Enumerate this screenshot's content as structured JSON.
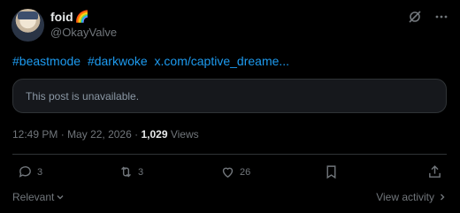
{
  "author": {
    "display_name": "foid",
    "emoji": "🌈",
    "handle": "@OkayValve"
  },
  "post": {
    "hashtag1": "#beastmode",
    "hashtag2": "#darkwoke",
    "link": "x.com/captive_dreame..."
  },
  "quote": {
    "text": "This post is unavailable."
  },
  "meta": {
    "time": "12:49 PM",
    "date": "May 22, 2026",
    "views_count": "1,029",
    "views_label": "Views"
  },
  "actions": {
    "replies": "3",
    "reposts": "3",
    "likes": "26"
  },
  "footer": {
    "sort_label": "Relevant",
    "view_activity_label": "View activity"
  },
  "colors": {
    "background": "#000000",
    "link": "#1d9bf0",
    "muted": "#71767b",
    "text": "#e7e9ea"
  }
}
